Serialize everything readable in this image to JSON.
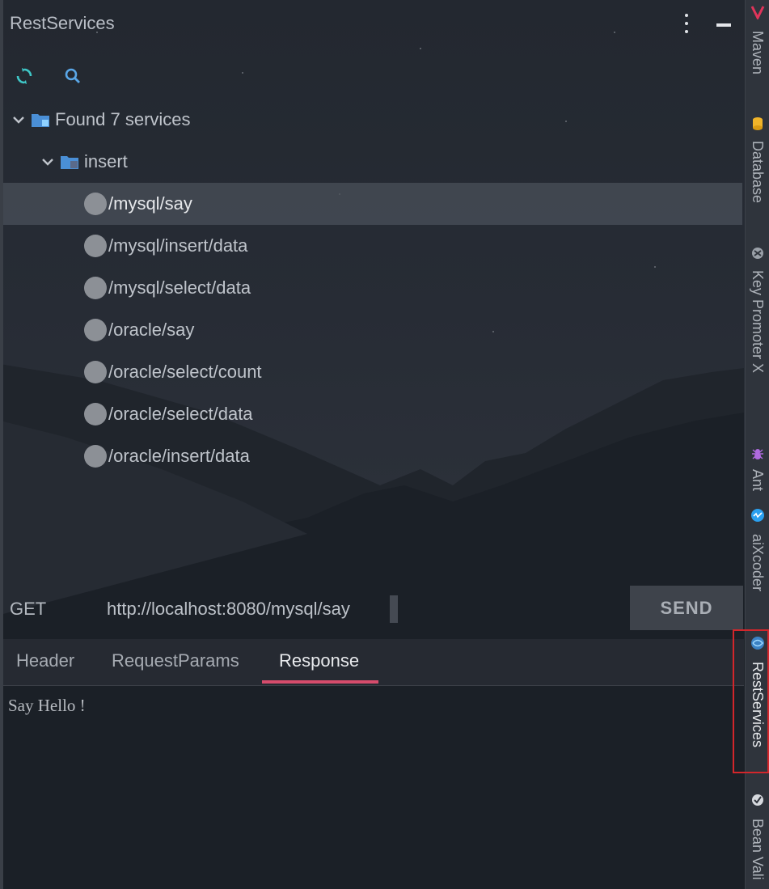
{
  "panel": {
    "title": "RestServices",
    "toolbar": {
      "refresh_icon": "refresh-icon",
      "search_icon": "search-icon"
    }
  },
  "tree": {
    "root_label": "Found 7 services",
    "group_label": "insert",
    "services": [
      "/mysql/say",
      "/mysql/insert/data",
      "/mysql/select/data",
      "/oracle/say",
      "/oracle/select/count",
      "/oracle/select/data",
      "/oracle/insert/data"
    ],
    "selected_index": 0
  },
  "request": {
    "method": "GET",
    "url": "http://localhost:8080/mysql/say",
    "send_label": "SEND"
  },
  "tabs": [
    "Header",
    "RequestParams",
    "Response"
  ],
  "active_tab": "Response",
  "response": {
    "body": "Say Hello !"
  },
  "sidebar": {
    "items": [
      "Maven",
      "Database",
      "Key Promoter X",
      "Ant",
      "aiXcoder",
      "RestServices",
      "Bean Vali"
    ],
    "active": "RestServices"
  },
  "colors": {
    "accent_tab": "#d64c6c",
    "highlight_border": "#d3262b",
    "folder_blue": "#4a8fd6",
    "refresh_icon": "#3fc7c7",
    "search_icon": "#5aa7e8"
  }
}
